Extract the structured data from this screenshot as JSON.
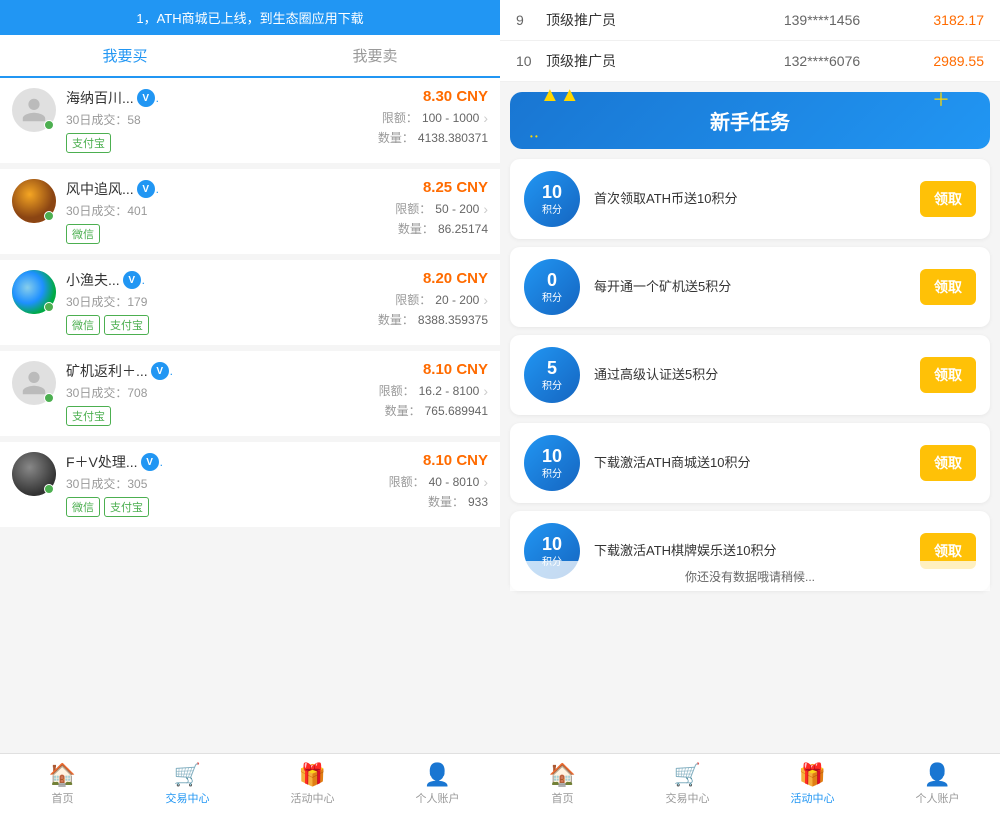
{
  "left": {
    "banner": "1，ATH商城已上线，到生态圈应用下载",
    "tabs": [
      {
        "label": "我要买",
        "active": true
      },
      {
        "label": "我要卖",
        "active": false
      }
    ],
    "listings": [
      {
        "id": 1,
        "name": "海纳百川...",
        "verified": true,
        "trades": "30日成交：",
        "trade_count": "58",
        "price": "8.30 CNY",
        "limit_label": "限额：",
        "limit_value": "100 - 1000",
        "quantity_label": "数量：",
        "quantity_value": "4138.380371",
        "payments": [
          "支付宝"
        ],
        "avatar_type": "placeholder",
        "online": true
      },
      {
        "id": 2,
        "name": "风中追风...",
        "verified": true,
        "trades": "30日成交：",
        "trade_count": "401",
        "price": "8.25 CNY",
        "limit_label": "限额：",
        "limit_value": "50 - 200",
        "quantity_label": "数量：",
        "quantity_value": "86.25174",
        "payments": [
          "微信"
        ],
        "avatar_type": "circle2",
        "online": true
      },
      {
        "id": 3,
        "name": "小渔夫...",
        "verified": true,
        "trades": "30日成交：",
        "trade_count": "179",
        "price": "8.20 CNY",
        "limit_label": "限额：",
        "limit_value": "20 - 200",
        "quantity_label": "数量：",
        "quantity_value": "8388.359375",
        "payments": [
          "微信",
          "支付宝"
        ],
        "avatar_type": "circle3",
        "online": true
      },
      {
        "id": 4,
        "name": "矿机返利＋...",
        "verified": true,
        "trades": "30日成交：",
        "trade_count": "708",
        "price": "8.10 CNY",
        "limit_label": "限额：",
        "limit_value": "16.2 - 8100",
        "quantity_label": "数量：",
        "quantity_value": "765.689941",
        "payments": [
          "支付宝"
        ],
        "avatar_type": "placeholder",
        "online": true
      },
      {
        "id": 5,
        "name": "F＋V处理...",
        "verified": true,
        "trades": "30日成交：",
        "trade_count": "305",
        "price": "8.10 CNY",
        "limit_label": "限额：",
        "limit_value": "40 - 8010",
        "quantity_label": "数量：",
        "quantity_value": "933",
        "payments": [
          "微信",
          "支付宝"
        ],
        "avatar_type": "circle2",
        "online": true
      }
    ],
    "nav": [
      {
        "label": "首页",
        "icon": "🏠",
        "active": false
      },
      {
        "label": "交易中心",
        "icon": "🛒",
        "active": true
      },
      {
        "label": "活动中心",
        "icon": "🎁",
        "active": false
      },
      {
        "label": "个人账户",
        "icon": "👤",
        "active": false
      }
    ]
  },
  "right": {
    "leaderboard": [
      {
        "rank": "9",
        "title": "顶级推广员",
        "phone": "139****1456",
        "amount": "3182.17"
      },
      {
        "rank": "10",
        "title": "顶级推广员",
        "phone": "132****6076",
        "amount": "2989.55"
      }
    ],
    "tasks_banner": {
      "title": "新手任务",
      "decoration": "▲",
      "plus": "＋",
      "dots": "• •"
    },
    "tasks": [
      {
        "points_num": "10",
        "points_label": "积分",
        "description": "首次领取ATH币送10积分",
        "btn_label": "领取"
      },
      {
        "points_num": "0",
        "points_label": "积分",
        "description": "每开通一个矿机送5积分",
        "btn_label": "领取"
      },
      {
        "points_num": "5",
        "points_label": "积分",
        "description": "通过高级认证送5积分",
        "btn_label": "领取"
      },
      {
        "points_num": "10",
        "points_label": "积分",
        "description": "下载激活ATH商城送10积分",
        "btn_label": "领取"
      },
      {
        "points_num": "10",
        "points_label": "积分",
        "description": "下载激活ATH棋牌娱乐送10积分",
        "btn_label": "领取"
      }
    ],
    "overlay_text": "你还没有数据哦请稍候...",
    "nav": [
      {
        "label": "首页",
        "icon": "🏠",
        "active": false
      },
      {
        "label": "交易中心",
        "icon": "🛒",
        "active": false
      },
      {
        "label": "活动中心",
        "icon": "🎁",
        "active": true
      },
      {
        "label": "个人账户",
        "icon": "👤",
        "active": false
      }
    ]
  }
}
